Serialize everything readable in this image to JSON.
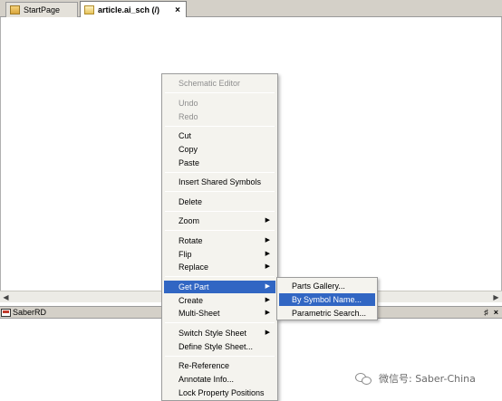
{
  "tabs": [
    {
      "label": "StartPage",
      "icon": "page-icon"
    },
    {
      "label": "article.ai_sch (/)",
      "icon": "schematic-icon"
    }
  ],
  "pane": {
    "title": "SaberRD",
    "pin_glyph": "♯",
    "close_glyph": "×"
  },
  "scroll": {
    "left": "◀",
    "right": "▶"
  },
  "watermark": "微信号: Saber-China",
  "menu": {
    "header": "Schematic Editor",
    "undo": "Undo",
    "redo": "Redo",
    "cut": "Cut",
    "copy": "Copy",
    "paste": "Paste",
    "insert_shared": "Insert Shared Symbols",
    "delete": "Delete",
    "zoom": "Zoom",
    "rotate": "Rotate",
    "flip": "Flip",
    "replace": "Replace",
    "get_part": "Get Part",
    "create": "Create",
    "multi_sheet": "Multi-Sheet",
    "switch_style": "Switch Style Sheet",
    "define_style": "Define Style Sheet...",
    "re_reference": "Re-Reference",
    "annotate": "Annotate Info...",
    "lock_props": "Lock Property Positions",
    "arrow": "▶"
  },
  "submenu": {
    "parts_gallery": "Parts Gallery...",
    "by_symbol": "By Symbol Name...",
    "parametric": "Parametric Search..."
  },
  "colors": {
    "highlight": "#3166c3",
    "chrome": "#d4d0c8"
  }
}
